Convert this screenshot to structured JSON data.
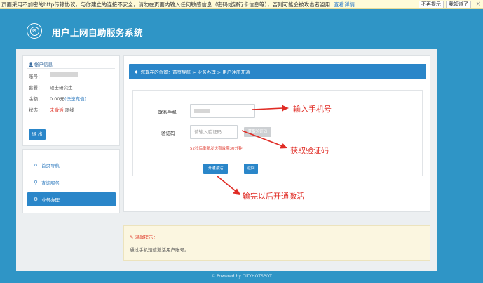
{
  "browser_bar": {
    "warning": "页面采用不加密的http传输协议，与你建立的连接不安全，请勿在页面内输入任何敏感信息（密码或银行卡信息等），否则可能会被攻击者盗用",
    "details_link": "查看详情",
    "no_remind": "不再提示",
    "got_it": "我知道了",
    "close": "×"
  },
  "header": {
    "logo_text": "℗",
    "title": "用户上网自助服务系统"
  },
  "account": {
    "title": "帐户信息",
    "account_label": "账号：",
    "plan_label": "套餐：",
    "plan_value": "硕士研究生",
    "balance_label": "余额：",
    "balance_value": "0.00元",
    "recharge_link": "(快速充值)",
    "status_label": "状态：",
    "status_value": "未激活",
    "status_extra": "离线",
    "logout": "退 出"
  },
  "nav": {
    "items": [
      {
        "label": "首页导航",
        "icon": "home-icon"
      },
      {
        "label": "查询服务",
        "icon": "search-icon"
      },
      {
        "label": "业务办理",
        "icon": "gear-icon",
        "active": true
      }
    ]
  },
  "main": {
    "breadcrumb": "您现在的位置：首页导航 > 业务办理 > 用户注册开通",
    "phone_label": "联系手机",
    "code_label": "验证码",
    "code_placeholder": "请输入验证码",
    "get_code": "获取验证码",
    "countdown_hint": "52秒后重新发送有效期30分钟",
    "activate_button": "开通激活",
    "back_button": "返回"
  },
  "tip": {
    "title": "温馨提示：",
    "text": "通过手机短信激活用户账号。"
  },
  "footer": "© Powered by CITYHOTSPOT",
  "annotations": {
    "phone": "输入手机号",
    "code": "获取验证码",
    "activate": "输完以后开通激活",
    "color": "#e02b24"
  },
  "colors": {
    "accent": "#2a86c9",
    "background": "#2f95c6",
    "warning": "#e03a2f"
  }
}
